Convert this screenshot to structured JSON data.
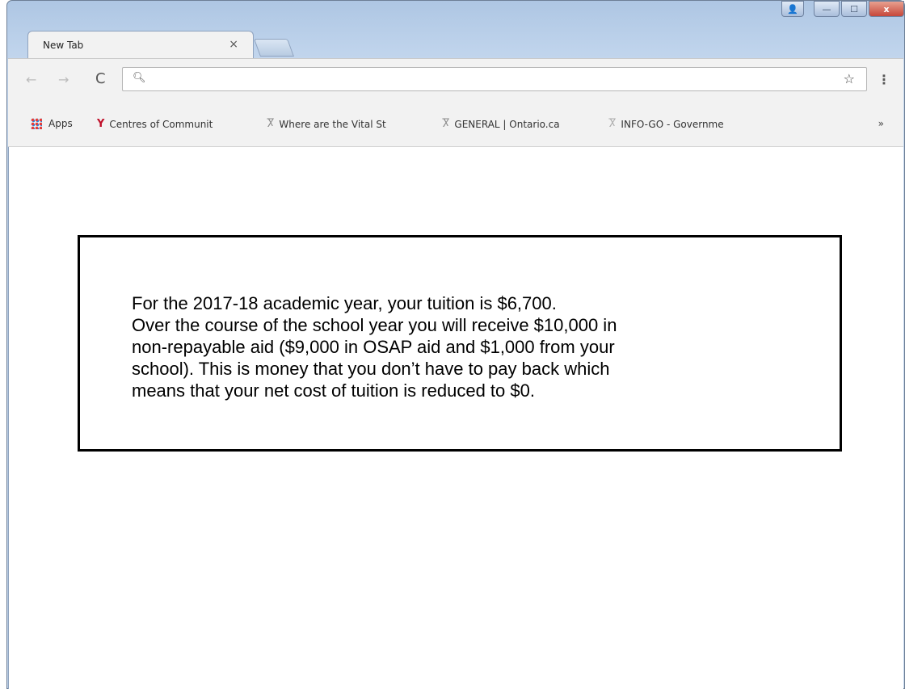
{
  "browser": {
    "tab": {
      "title": "New Tab",
      "close_glyph": "×"
    },
    "window_controls": {
      "minimize": "—",
      "maximize": "☐",
      "close": "x",
      "profile": "👤"
    },
    "nav": {
      "back": "←",
      "forward": "→",
      "reload": "C"
    },
    "omnibox": {
      "value": "",
      "placeholder": ""
    },
    "menu_glyph": "⋮",
    "star_glyph": "☆",
    "bookmarks": [
      {
        "icon": "apps-icon",
        "label": "Apps"
      },
      {
        "icon": "y-logo-icon",
        "label": "Centres of Communit"
      },
      {
        "icon": "ontario-logo-icon",
        "label": "Where are the Vital St"
      },
      {
        "icon": "ontario-logo-icon",
        "label": "GENERAL | Ontario.ca"
      },
      {
        "icon": "ontario-logo-icon",
        "label": "INFO-GO - Governme"
      }
    ],
    "bookmarks_overflow": "»"
  },
  "content": {
    "lines": [
      "For the 2017-18 academic year, your tuition is $6,700.",
      "Over the course of the school year you will receive $10,000 in",
      "non-repayable aid ($9,000 in OSAP aid and $1,000 from your",
      "school). This is money that you don’t have to pay back which",
      "means that your net cost of tuition is reduced to $0."
    ]
  },
  "colors": {
    "titlebar": "#b9cfe9",
    "toolbar": "#f2f2f2",
    "close_button": "#c6473a",
    "apps_red": "#e53935",
    "y_logo_red": "#c0102a"
  }
}
